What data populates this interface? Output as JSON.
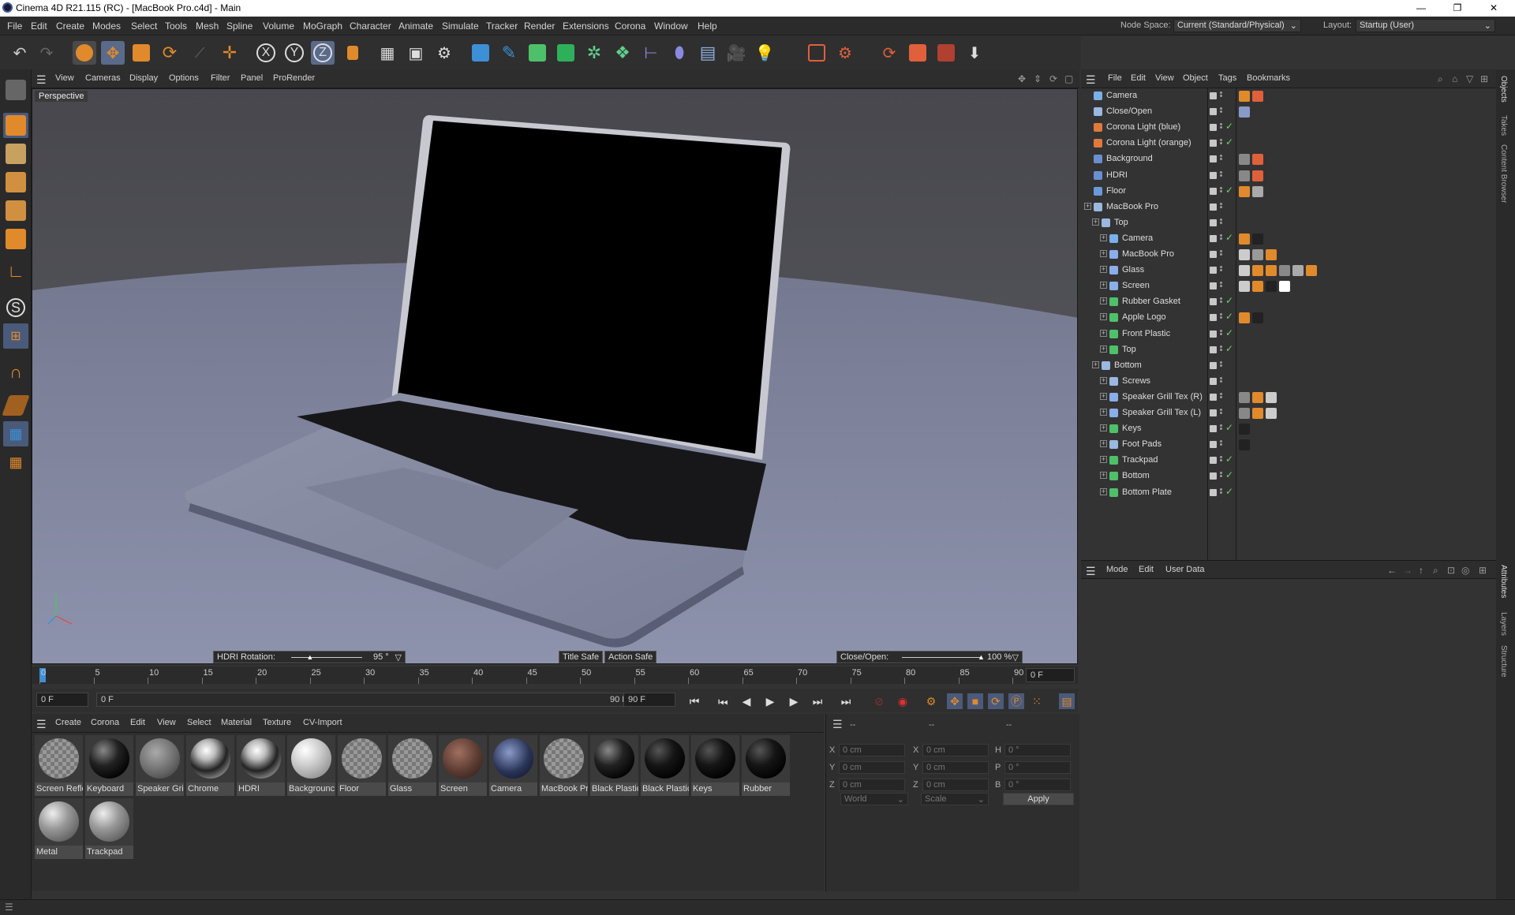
{
  "window": {
    "title": "Cinema 4D R21.115 (RC) - [MacBook Pro.c4d] - Main",
    "minimize": "—",
    "restore": "❐",
    "close": "✕"
  },
  "menu": [
    "File",
    "Edit",
    "Create",
    "Modes",
    "Select",
    "Tools",
    "Mesh",
    "Spline",
    "Volume",
    "MoGraph",
    "Character",
    "Animate",
    "Simulate",
    "Tracker",
    "Render",
    "Extensions",
    "Corona",
    "Window",
    "Help"
  ],
  "nodespace": {
    "label": "Node Space:",
    "value": "Current (Standard/Physical)"
  },
  "layout": {
    "label": "Layout:",
    "value": "Startup (User)"
  },
  "viewport": {
    "menu": [
      "View",
      "Cameras",
      "Display",
      "Options",
      "Filter",
      "Panel",
      "ProRender"
    ],
    "camera_label": "Perspective",
    "hud_hdri_label": "HDRI Rotation:",
    "hud_hdri_value": "95 °",
    "hud_title_safe": "Title Safe",
    "hud_action_safe": "Action Safe",
    "hud_close_label": "Close/Open:",
    "hud_close_value": "100 %",
    "hdri_rotation_fraction": 0.26,
    "close_open_fraction": 1.0
  },
  "timeline": {
    "ticks": [
      "0",
      "5",
      "10",
      "15",
      "20",
      "25",
      "30",
      "35",
      "40",
      "45",
      "50",
      "55",
      "60",
      "65",
      "70",
      "75",
      "80",
      "85",
      "90"
    ],
    "current_frame": "0 F",
    "start": "0 F",
    "range_start": "0 F",
    "range_end": "90 F",
    "end": "90 F"
  },
  "transport": {
    "first": "⏮",
    "prev_key": "⏭",
    "prev_frame": "◀",
    "play": "▶",
    "next_frame": "▶",
    "next_key": "⏭",
    "last": "⏭"
  },
  "material_menu": [
    "Create",
    "Corona",
    "Edit",
    "View",
    "Select",
    "Material",
    "Texture",
    "CV-Import"
  ],
  "materials": [
    {
      "name": "Screen Refle",
      "style": "checker"
    },
    {
      "name": "Keyboard",
      "style": "dark"
    },
    {
      "name": "Speaker Gri",
      "style": "mesh"
    },
    {
      "name": "Chrome",
      "style": "chrome"
    },
    {
      "name": "HDRI",
      "style": "chrome"
    },
    {
      "name": "Backgrounc",
      "style": "light"
    },
    {
      "name": "Floor",
      "style": "checker"
    },
    {
      "name": "Glass",
      "style": "checker"
    },
    {
      "name": "Screen",
      "style": "brown"
    },
    {
      "name": "Camera",
      "style": "blue"
    },
    {
      "name": "MacBook Pr",
      "style": "checker"
    },
    {
      "name": "Black Plastic",
      "style": "dark"
    },
    {
      "name": "Black Plastic",
      "style": "black"
    },
    {
      "name": "Keys",
      "style": "black"
    },
    {
      "name": "Rubber",
      "style": "black"
    },
    {
      "name": "Metal",
      "style": "metal"
    },
    {
      "name": "Trackpad",
      "style": "metal"
    }
  ],
  "coords": {
    "headers": [
      "--",
      "--",
      "--"
    ],
    "rows": [
      {
        "a": "X",
        "av": "0 cm",
        "b": "X",
        "bv": "0 cm",
        "c": "H",
        "cv": "0 °"
      },
      {
        "a": "Y",
        "av": "0 cm",
        "b": "Y",
        "bv": "0 cm",
        "c": "P",
        "cv": "0 °"
      },
      {
        "a": "Z",
        "av": "0 cm",
        "b": "Z",
        "bv": "0 cm",
        "c": "B",
        "cv": "0 °"
      }
    ],
    "space": "World",
    "mode": "Scale",
    "apply": "Apply"
  },
  "object_menu": [
    "File",
    "Edit",
    "View",
    "Object",
    "Tags",
    "Bookmarks"
  ],
  "objects": [
    {
      "name": "Camera",
      "icon": "camera-icon",
      "indent": 0,
      "check": false
    },
    {
      "name": "Close/Open",
      "icon": "null-icon",
      "indent": 0,
      "check": false
    },
    {
      "name": "Corona Light (blue)",
      "icon": "light-icon",
      "indent": 0,
      "check": true
    },
    {
      "name": "Corona Light (orange)",
      "icon": "light-icon",
      "indent": 0,
      "check": true
    },
    {
      "name": "Background",
      "icon": "sphere-icon",
      "indent": 0,
      "check": false
    },
    {
      "name": "HDRI",
      "icon": "sphere-icon",
      "indent": 0,
      "check": false
    },
    {
      "name": "Floor",
      "icon": "floor-icon",
      "indent": 0,
      "check": true
    },
    {
      "name": "MacBook Pro",
      "icon": "null-icon",
      "indent": 0,
      "check": false
    },
    {
      "name": "Top",
      "icon": "null-icon",
      "indent": 1,
      "check": false
    },
    {
      "name": "Camera",
      "icon": "camera-icon",
      "indent": 2,
      "check": true
    },
    {
      "name": "MacBook Pro",
      "icon": "poly-icon",
      "indent": 2,
      "check": false
    },
    {
      "name": "Glass",
      "icon": "poly-icon",
      "indent": 2,
      "check": false
    },
    {
      "name": "Screen",
      "icon": "poly-icon",
      "indent": 2,
      "check": false
    },
    {
      "name": "Rubber Gasket",
      "icon": "green-icon",
      "indent": 2,
      "check": true
    },
    {
      "name": "Apple Logo",
      "icon": "green-icon",
      "indent": 2,
      "check": true
    },
    {
      "name": "Front Plastic",
      "icon": "green-icon",
      "indent": 2,
      "check": true
    },
    {
      "name": "Top",
      "icon": "green-icon",
      "indent": 2,
      "check": true
    },
    {
      "name": "Bottom",
      "icon": "null-icon",
      "indent": 1,
      "check": false
    },
    {
      "name": "Screws",
      "icon": "null-icon",
      "indent": 2,
      "check": false
    },
    {
      "name": "Speaker Grill Tex (R)",
      "icon": "poly-icon",
      "indent": 2,
      "check": false
    },
    {
      "name": "Speaker Grill Tex (L)",
      "icon": "poly-icon",
      "indent": 2,
      "check": false
    },
    {
      "name": "Keys",
      "icon": "green-icon",
      "indent": 2,
      "check": true
    },
    {
      "name": "Foot Pads",
      "icon": "null-icon",
      "indent": 2,
      "check": false
    },
    {
      "name": "Trackpad",
      "icon": "green-icon",
      "indent": 2,
      "check": true
    },
    {
      "name": "Bottom",
      "icon": "green-icon",
      "indent": 2,
      "check": true
    },
    {
      "name": "Bottom Plate",
      "icon": "green-icon",
      "indent": 2,
      "check": true
    }
  ],
  "attr_menu": [
    "Mode",
    "Edit",
    "User Data"
  ],
  "right_tabs": [
    "Objects",
    "Takes",
    "Content Browser",
    "Attributes",
    "Layers",
    "Structure"
  ],
  "colors": {
    "accent": "#e08a2c",
    "blue": "#3d8fd6",
    "green": "#4fc06a",
    "floor": "#8a8fa8"
  }
}
